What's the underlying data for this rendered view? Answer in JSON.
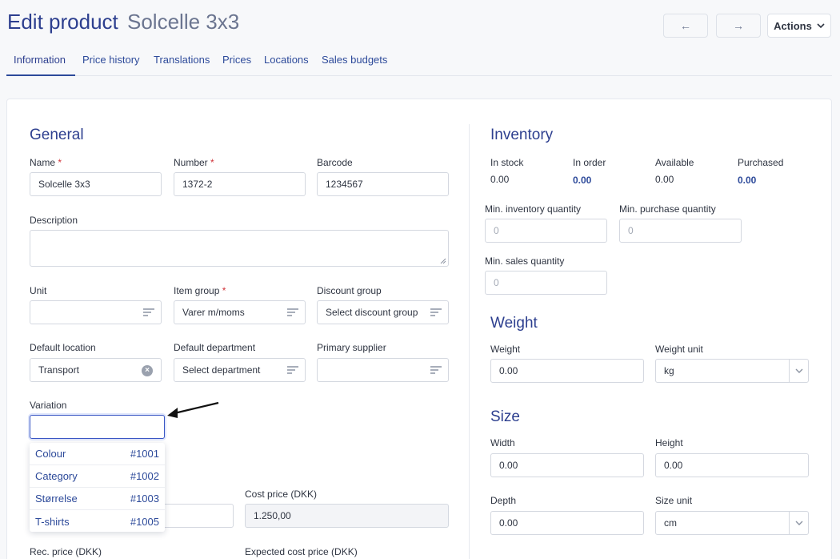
{
  "header": {
    "title": "Edit product",
    "subtitle": "Solcelle 3x3",
    "prev_label": "←",
    "next_label": "→",
    "actions_label": "Actions"
  },
  "tabs": [
    {
      "label": "Information"
    },
    {
      "label": "Price history"
    },
    {
      "label": "Translations"
    },
    {
      "label": "Prices"
    },
    {
      "label": "Locations"
    },
    {
      "label": "Sales budgets"
    }
  ],
  "general": {
    "title": "General",
    "name_label": "Name",
    "name_value": "Solcelle 3x3",
    "number_label": "Number",
    "number_value": "1372-2",
    "barcode_label": "Barcode",
    "barcode_value": "1234567",
    "description_label": "Description",
    "description_value": "",
    "unit_label": "Unit",
    "unit_value": "",
    "item_group_label": "Item group",
    "item_group_value": "Varer m/moms",
    "discount_group_label": "Discount group",
    "discount_group_placeholder": "Select discount group",
    "default_location_label": "Default location",
    "default_location_value": "Transport",
    "default_department_label": "Default department",
    "default_department_placeholder": "Select department",
    "primary_supplier_label": "Primary supplier",
    "primary_supplier_value": "",
    "variation_label": "Variation",
    "variation_value": "",
    "cost_price_label": "Cost price (DKK)",
    "cost_price_value": "1.250,00",
    "rec_price_label": "Rec. price (DKK)",
    "expected_cost_price_label": "Expected cost price (DKK)",
    "required_mark": "*"
  },
  "variation_options": [
    {
      "name": "Colour",
      "code": "#1001"
    },
    {
      "name": "Category",
      "code": "#1002"
    },
    {
      "name": "Størrelse",
      "code": "#1003"
    },
    {
      "name": "T-shirts",
      "code": "#1005"
    }
  ],
  "inventory": {
    "title": "Inventory",
    "in_stock_label": "In stock",
    "in_stock_value": "0.00",
    "in_order_label": "In order",
    "in_order_value": "0.00",
    "available_label": "Available",
    "available_value": "0.00",
    "purchased_label": "Purchased",
    "purchased_value": "0.00",
    "min_inventory_label": "Min. inventory quantity",
    "min_inventory_placeholder": "0",
    "min_purchase_label": "Min. purchase quantity",
    "min_purchase_placeholder": "0",
    "min_sales_label": "Min. sales quantity",
    "min_sales_placeholder": "0"
  },
  "weight": {
    "title": "Weight",
    "weight_label": "Weight",
    "weight_value": "0.00",
    "unit_label": "Weight unit",
    "unit_value": "kg"
  },
  "size": {
    "title": "Size",
    "width_label": "Width",
    "width_value": "0.00",
    "height_label": "Height",
    "height_value": "0.00",
    "depth_label": "Depth",
    "depth_value": "0.00",
    "unit_label": "Size unit",
    "unit_value": "cm"
  },
  "colors": {
    "accent": "#2d3f8f",
    "link": "#2d4a9a",
    "required": "#d0343a",
    "focus": "#3a57c4"
  },
  "icons": {
    "prev": "arrow-left-icon",
    "next": "arrow-right-icon",
    "actions": "chevron-down-icon",
    "select": "list-filter-icon",
    "clear": "clear-icon",
    "annotation": "annotation-arrow-icon"
  }
}
